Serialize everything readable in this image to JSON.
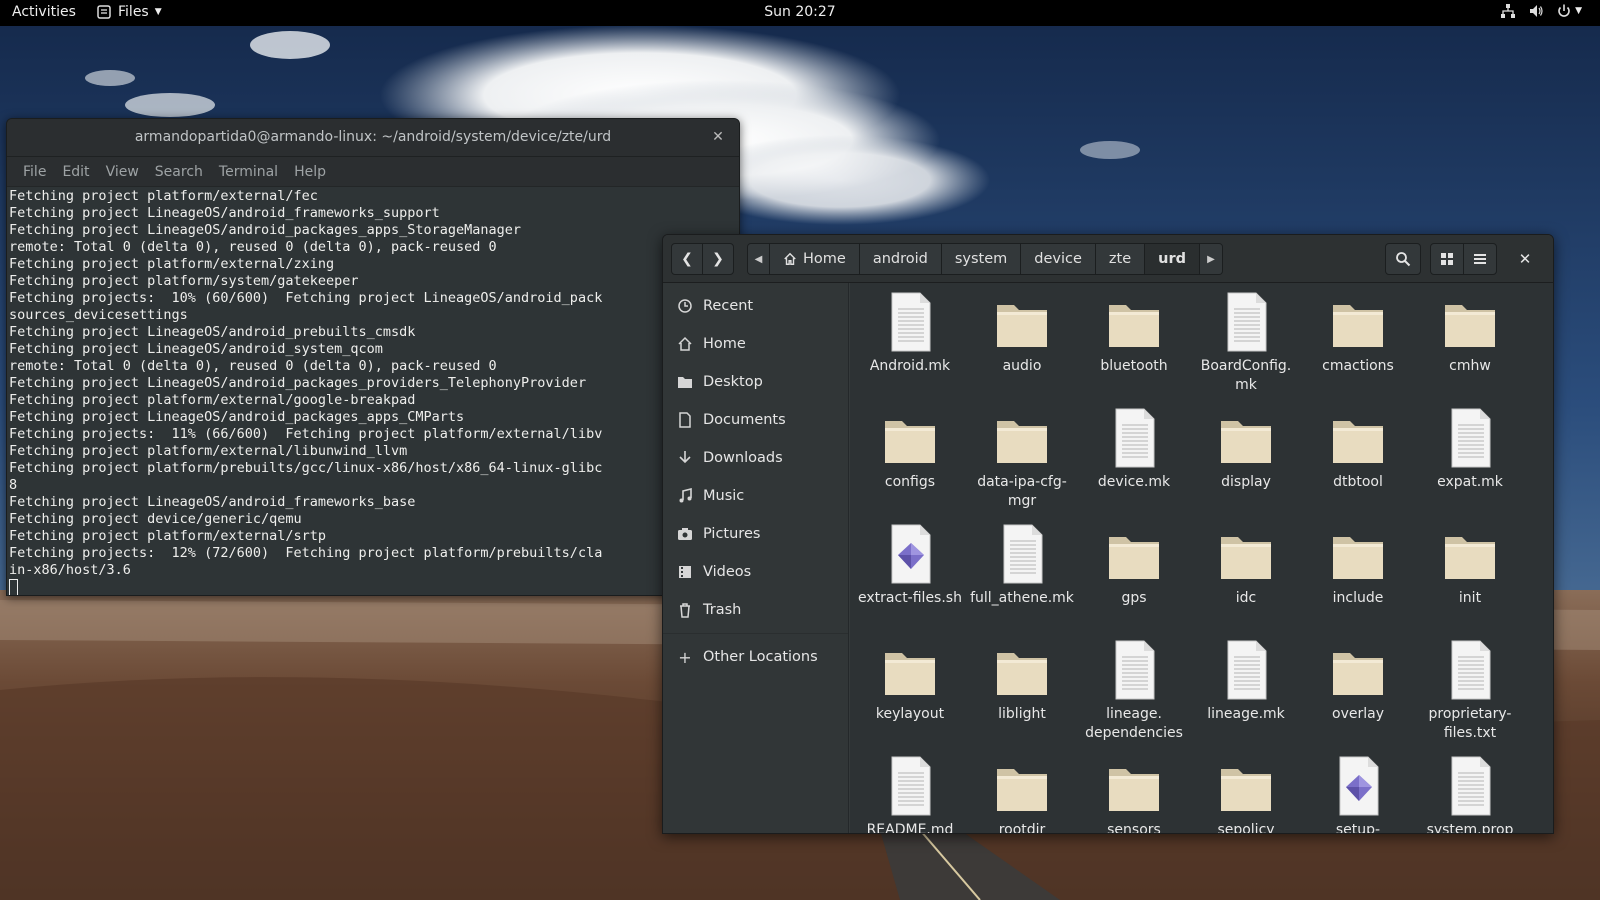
{
  "topbar": {
    "activities": "Activities",
    "app_menu": "Files",
    "clock": "Sun 20:27"
  },
  "terminal": {
    "title": "armandopartida0@armando-linux: ~/android/system/device/zte/urd",
    "menu": [
      "File",
      "Edit",
      "View",
      "Search",
      "Terminal",
      "Help"
    ],
    "output": "Fetching project platform/external/fec\nFetching project LineageOS/android_frameworks_support\nFetching project LineageOS/android_packages_apps_StorageManager\nremote: Total 0 (delta 0), reused 0 (delta 0), pack-reused 0\nFetching project platform/external/zxing\nFetching project platform/system/gatekeeper\nFetching projects:  10% (60/600)  Fetching project LineageOS/android_pack\nsources_devicesettings\nFetching project LineageOS/android_prebuilts_cmsdk\nFetching project LineageOS/android_system_qcom\nremote: Total 0 (delta 0), reused 0 (delta 0), pack-reused 0\nFetching project LineageOS/android_packages_providers_TelephonyProvider\nFetching project platform/external/google-breakpad\nFetching project LineageOS/android_packages_apps_CMParts\nFetching projects:  11% (66/600)  Fetching project platform/external/libv\nFetching project platform/external/libunwind_llvm\nFetching project platform/prebuilts/gcc/linux-x86/host/x86_64-linux-glibc\n8\nFetching project LineageOS/android_frameworks_base\nFetching project device/generic/qemu\nFetching project platform/external/srtp\nFetching projects:  12% (72/600)  Fetching project platform/prebuilts/cla\nin-x86/host/3.6\n"
  },
  "files": {
    "pathbar": [
      "Home",
      "android",
      "system",
      "device",
      "zte",
      "urd"
    ],
    "sidebar": [
      {
        "label": "Recent",
        "icon": "clock-icon"
      },
      {
        "label": "Home",
        "icon": "home-icon"
      },
      {
        "label": "Desktop",
        "icon": "folder-icon"
      },
      {
        "label": "Documents",
        "icon": "document-icon"
      },
      {
        "label": "Downloads",
        "icon": "download-icon"
      },
      {
        "label": "Music",
        "icon": "music-icon"
      },
      {
        "label": "Pictures",
        "icon": "camera-icon"
      },
      {
        "label": "Videos",
        "icon": "film-icon"
      },
      {
        "label": "Trash",
        "icon": "trash-icon"
      },
      {
        "label": "Other Locations",
        "icon": "plus-icon"
      }
    ],
    "items": [
      {
        "name": "Android.mk",
        "kind": "file"
      },
      {
        "name": "audio",
        "kind": "folder"
      },
      {
        "name": "bluetooth",
        "kind": "folder"
      },
      {
        "name": "BoardConfig.\nmk",
        "kind": "file"
      },
      {
        "name": "cmactions",
        "kind": "folder"
      },
      {
        "name": "cmhw",
        "kind": "folder"
      },
      {
        "name": "configs",
        "kind": "folder"
      },
      {
        "name": "data-ipa-cfg-\nmgr",
        "kind": "folder"
      },
      {
        "name": "device.mk",
        "kind": "file"
      },
      {
        "name": "display",
        "kind": "folder"
      },
      {
        "name": "dtbtool",
        "kind": "folder"
      },
      {
        "name": "expat.mk",
        "kind": "file"
      },
      {
        "name": "extract-files.sh",
        "kind": "script"
      },
      {
        "name": "full_athene.mk",
        "kind": "file"
      },
      {
        "name": "gps",
        "kind": "folder"
      },
      {
        "name": "idc",
        "kind": "folder"
      },
      {
        "name": "include",
        "kind": "folder"
      },
      {
        "name": "init",
        "kind": "folder"
      },
      {
        "name": "keylayout",
        "kind": "folder"
      },
      {
        "name": "liblight",
        "kind": "folder"
      },
      {
        "name": "lineage.\ndependencies",
        "kind": "file"
      },
      {
        "name": "lineage.mk",
        "kind": "file"
      },
      {
        "name": "overlay",
        "kind": "folder"
      },
      {
        "name": "proprietary-\nfiles.txt",
        "kind": "file"
      },
      {
        "name": "README.md",
        "kind": "file"
      },
      {
        "name": "rootdir",
        "kind": "folder"
      },
      {
        "name": "sensors",
        "kind": "folder"
      },
      {
        "name": "sepolicy",
        "kind": "folder"
      },
      {
        "name": "setup-\nmakefiles.sh",
        "kind": "script"
      },
      {
        "name": "system.prop",
        "kind": "file"
      }
    ]
  },
  "colors": {
    "topbar": "#000000",
    "terminal_bg": "#2e3436",
    "files_bg": "#2d3234",
    "folder": "#e8dcc0",
    "script_gem": "#7b6fc9"
  }
}
